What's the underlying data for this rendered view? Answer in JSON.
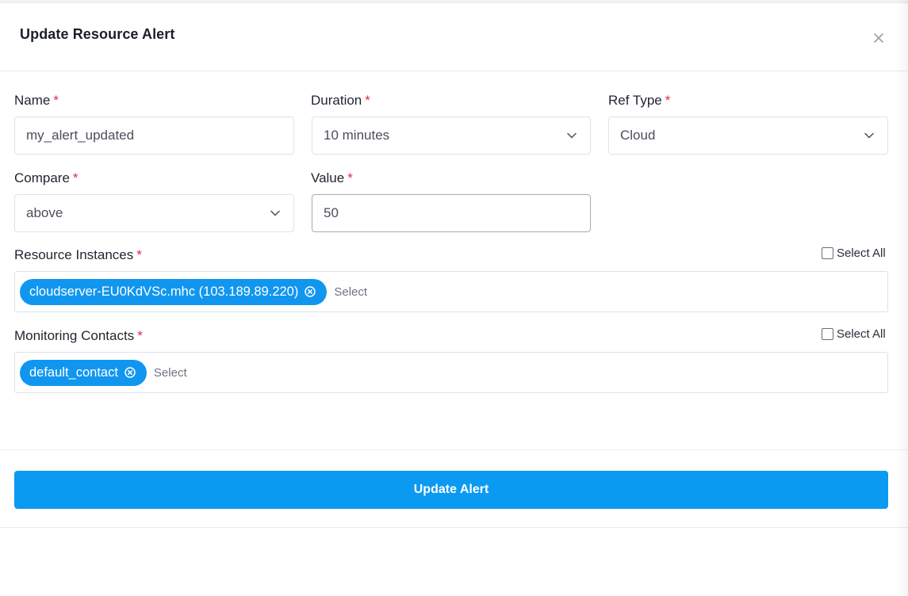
{
  "modal": {
    "title": "Update Resource Alert",
    "required_mark": "*"
  },
  "fields": {
    "name": {
      "label": "Name",
      "value": "my_alert_updated"
    },
    "duration": {
      "label": "Duration",
      "value": "10 minutes"
    },
    "ref_type": {
      "label": "Ref Type",
      "value": "Cloud"
    },
    "compare": {
      "label": "Compare",
      "value": "above"
    },
    "value": {
      "label": "Value",
      "value": "50"
    }
  },
  "resource_instances": {
    "label": "Resource Instances",
    "select_all_label": "Select All",
    "select_all_checked": false,
    "tags": [
      "cloudserver-EU0KdVSc.mhc (103.189.89.220)"
    ],
    "placeholder": "Select"
  },
  "monitoring_contacts": {
    "label": "Monitoring Contacts",
    "select_all_label": "Select All",
    "select_all_checked": false,
    "tags": [
      "default_contact"
    ],
    "placeholder": "Select"
  },
  "submit_label": "Update Alert",
  "colors": {
    "accent": "#0a9af2",
    "tag": "#1196f0",
    "required": "#e0294a"
  },
  "icons": {
    "close": "close-icon",
    "chevron": "chevron-down-icon",
    "tag_remove": "remove-tag-icon"
  }
}
